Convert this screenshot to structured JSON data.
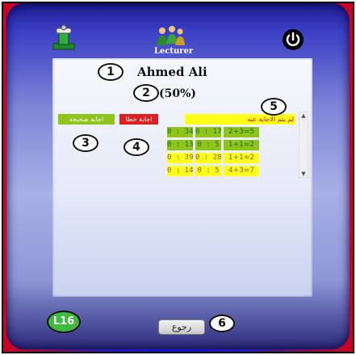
{
  "toolbar": {
    "exam_icon": "exam-stand-icon",
    "lecturer_icon": "lecturer-people-icon",
    "lecturer_label": "Lecturer",
    "power_icon": "power-icon"
  },
  "student": {
    "name": "Ahmed Ali",
    "score": "(50%)"
  },
  "legend": {
    "unanswered": "لم يتم الاجابة عنه",
    "wrong": "اجابة خطا",
    "correct": "اجابة صحيحة"
  },
  "answers": [
    {
      "min": "0 : 34",
      "sec": "0 : 17",
      "equation": "2+3=5",
      "status": "correct"
    },
    {
      "min": "0 : 13",
      "sec": "0 : 5",
      "equation": "1+1=2",
      "status": "correct"
    },
    {
      "min": "0 : 39",
      "sec": "0 : 28",
      "equation": "1+1=2",
      "status": "unanswered"
    },
    {
      "min": "0 : 14",
      "sec": "0 : 5",
      "equation": "4+3=7",
      "status": "unanswered"
    }
  ],
  "callouts": [
    "1",
    "2",
    "3",
    "4",
    "5",
    "6"
  ],
  "level_badge": "L16",
  "back_button": "رجوع",
  "colors": {
    "correct": "#8fc41a",
    "wrong": "#e02020",
    "unanswered": "#ffff1a",
    "badge": "#3dbb3d"
  }
}
